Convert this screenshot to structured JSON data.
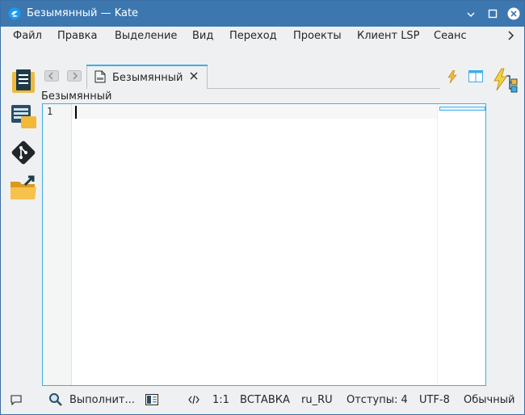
{
  "window": {
    "title": "Безымянный  — Kate"
  },
  "menubar": {
    "items": [
      "Файл",
      "Правка",
      "Выделение",
      "Вид",
      "Переход",
      "Проекты",
      "Клиент LSP",
      "Сеанс"
    ]
  },
  "sidepanel": {
    "buttons": [
      "documents-icon",
      "projects-icon",
      "git-icon",
      "filesystem-browser-icon"
    ]
  },
  "tabs": [
    {
      "label": "Безымянный",
      "active": true
    }
  ],
  "document": {
    "name_label": "Безымянный",
    "line_numbers": [
      "1"
    ]
  },
  "statusbar": {
    "search_label": "Выполнит...",
    "cursor_position": "1:1",
    "input_mode": "ВСТАВКА",
    "dictionary": "ru_RU",
    "indentation": "Отступы: 4",
    "encoding": "UTF-8",
    "syntax_mode": "Обычный"
  },
  "colors": {
    "titlebar": "#3d77b0",
    "accent": "#3daee9",
    "window_bg": "#eff0f1",
    "editor_bg": "#ffffff"
  }
}
